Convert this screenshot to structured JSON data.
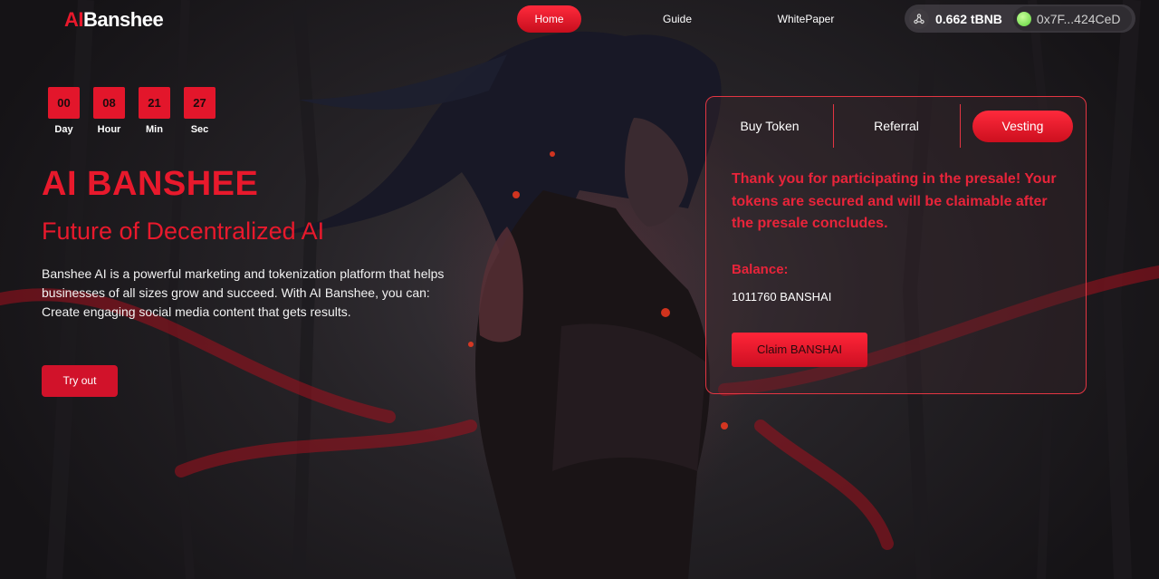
{
  "brand": {
    "logo_ai": "AI",
    "logo_rest": "Banshee"
  },
  "nav": {
    "items": [
      {
        "label": "Home",
        "active": true
      },
      {
        "label": "Guide",
        "active": false
      },
      {
        "label": "WhitePaper",
        "active": false
      }
    ]
  },
  "wallet": {
    "balance": "0.662 tBNB",
    "address": "0x7F...424CeD",
    "network_icon": "network-icon",
    "status_color": "#5cd13a"
  },
  "countdown": [
    {
      "value": "00",
      "label": "Day"
    },
    {
      "value": "08",
      "label": "Hour"
    },
    {
      "value": "21",
      "label": "Min"
    },
    {
      "value": "27",
      "label": "Sec"
    }
  ],
  "hero": {
    "title": "AI BANSHEE",
    "subtitle": "Future of Decentralized AI",
    "description": "Banshee AI is a powerful marketing and tokenization platform that helps businesses of all sizes grow and succeed. With AI Banshee, you can: Create engaging social media content that gets results.",
    "cta_label": "Try out"
  },
  "panel": {
    "tabs": [
      {
        "label": "Buy Token",
        "active": false
      },
      {
        "label": "Referral",
        "active": false
      },
      {
        "label": "Vesting",
        "active": true
      }
    ],
    "message": "Thank you for participating in the presale! Your tokens are secured and will be claimable after the presale concludes.",
    "balance_label": "Balance:",
    "balance_value": "1011760 BANSHAI",
    "claim_label": "Claim BANSHAI"
  },
  "colors": {
    "accent": "#e8192c",
    "panel_border": "#e33542"
  }
}
